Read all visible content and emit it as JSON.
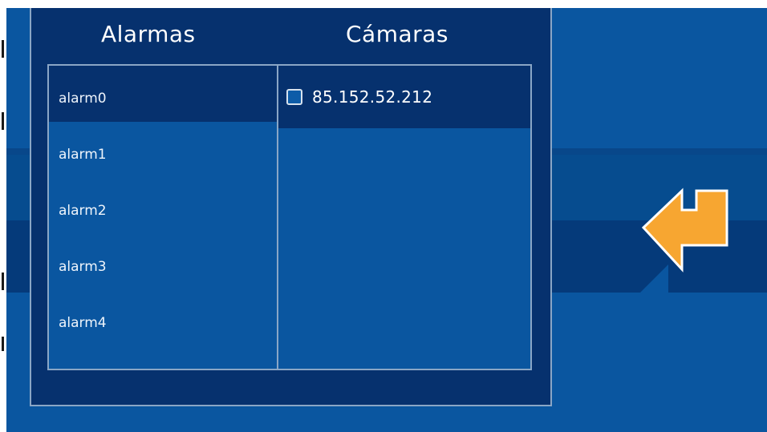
{
  "dialog": {
    "alarms_title": "Alarmas",
    "cameras_title": "Cámaras"
  },
  "alarms": {
    "items": [
      {
        "label": "alarm0",
        "selected": true
      },
      {
        "label": "alarm1",
        "selected": false
      },
      {
        "label": "alarm2",
        "selected": false
      },
      {
        "label": "alarm3",
        "selected": false
      },
      {
        "label": "alarm4",
        "selected": false
      }
    ]
  },
  "cameras": {
    "items": [
      {
        "label": "85.152.52.212",
        "checked": false
      }
    ]
  },
  "icons": {
    "back": "return-arrow-icon"
  },
  "colors": {
    "background": "#0a56a0",
    "panel": "#06316e",
    "border": "#8aa6c6",
    "accent": "#f7a631"
  }
}
